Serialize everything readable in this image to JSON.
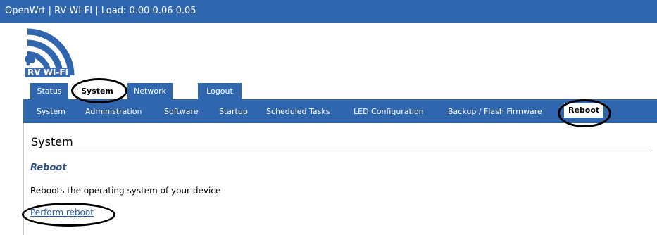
{
  "header": {
    "title": "OpenWrt | RV WI-FI | Load: 0.00 0.06 0.05"
  },
  "logo": {
    "text": "RV WI-FI",
    "icon": "wifi-rv-logo",
    "color": "#2f66ad"
  },
  "tabs": [
    {
      "label": "Status",
      "active": false
    },
    {
      "label": "System",
      "active": true
    },
    {
      "label": "Network",
      "active": false
    },
    {
      "label": "Logout",
      "active": false
    }
  ],
  "subnav": [
    {
      "label": "System",
      "active": false
    },
    {
      "label": "Administration",
      "active": false
    },
    {
      "label": "Software",
      "active": false
    },
    {
      "label": "Startup",
      "active": false
    },
    {
      "label": "Scheduled Tasks",
      "active": false
    },
    {
      "label": "LED Configuration",
      "active": false
    },
    {
      "label": "Backup / Flash Firmware",
      "active": false
    },
    {
      "label": "Reboot",
      "active": true
    }
  ],
  "main": {
    "section_title": "System",
    "subsection_title": "Reboot",
    "description": "Reboots the operating system of your device",
    "action_link": "Perform reboot"
  },
  "colors": {
    "accent": "#2f66ad",
    "link": "#2a5db0",
    "heading": "#2f4f86"
  }
}
